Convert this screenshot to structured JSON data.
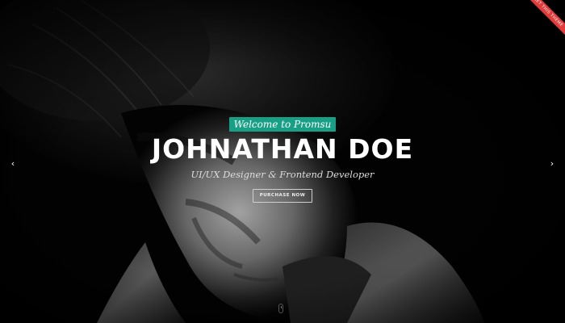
{
  "hero": {
    "welcome_text": "Welcome to Promsu",
    "name": "JOHNATHAN DOE",
    "tagline": "UI/UX Designer & Frontend Developer",
    "button_label": "PURCHASE NOW",
    "ribbon_text": "GET THIS THEME"
  },
  "nav": {
    "prev_arrow": "‹",
    "next_arrow": "›"
  },
  "colors": {
    "accent": "#17a085",
    "ribbon": "#e23b3b",
    "background": "#000000",
    "text": "#ffffff"
  },
  "icons": {
    "prev": "chevron-left-icon",
    "next": "chevron-right-icon",
    "scroll": "mouse-scroll-icon"
  }
}
